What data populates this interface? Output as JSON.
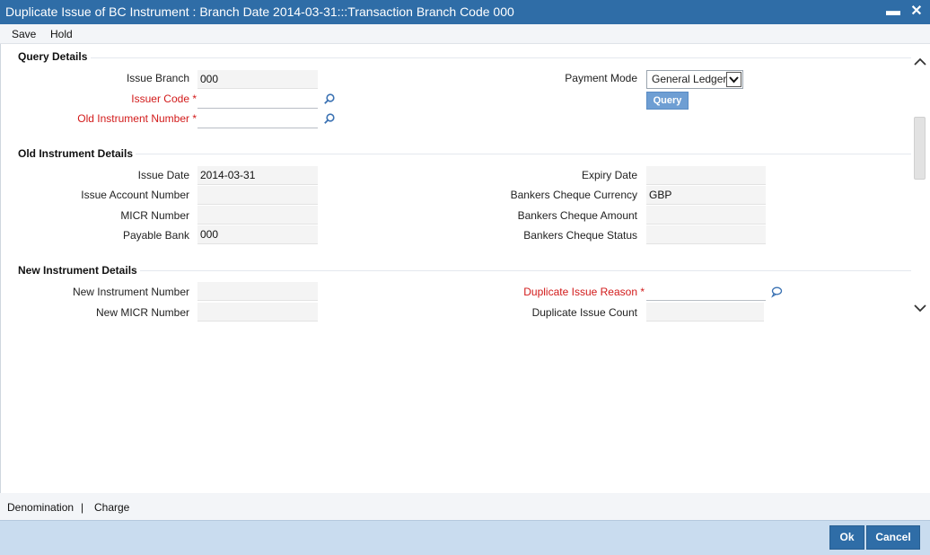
{
  "window": {
    "title": "Duplicate Issue of BC Instrument : Branch Date 2014-03-31:::Transaction Branch Code 000",
    "minimize_glyph": "▬",
    "close_glyph": "✕"
  },
  "menu": {
    "save": "Save",
    "hold": "Hold"
  },
  "query_details": {
    "heading": "Query Details",
    "issue_branch": {
      "label": "Issue Branch",
      "value": "000"
    },
    "issuer_code": {
      "label": "Issuer Code *",
      "value": ""
    },
    "old_instrument_number": {
      "label": "Old Instrument Number *",
      "value": ""
    },
    "payment_mode": {
      "label": "Payment Mode",
      "value": "General Ledger"
    },
    "query_button": "Query"
  },
  "old_instrument": {
    "heading": "Old Instrument Details",
    "issue_date": {
      "label": "Issue Date",
      "value": "2014-03-31"
    },
    "issue_account_number": {
      "label": "Issue Account Number",
      "value": ""
    },
    "micr_number": {
      "label": "MICR Number",
      "value": ""
    },
    "payable_bank": {
      "label": "Payable Bank",
      "value": "000"
    },
    "expiry_date": {
      "label": "Expiry Date",
      "value": ""
    },
    "bankers_cheque_currency": {
      "label": "Bankers Cheque Currency",
      "value": "GBP"
    },
    "bankers_cheque_amount": {
      "label": "Bankers Cheque Amount",
      "value": ""
    },
    "bankers_cheque_status": {
      "label": "Bankers Cheque Status",
      "value": ""
    }
  },
  "new_instrument": {
    "heading": "New Instrument Details",
    "new_instrument_number": {
      "label": "New Instrument Number",
      "value": ""
    },
    "new_micr_number": {
      "label": "New MICR Number",
      "value": ""
    },
    "duplicate_issue_reason": {
      "label": "Duplicate Issue Reason *",
      "value": ""
    },
    "duplicate_issue_count": {
      "label": "Duplicate Issue Count",
      "value": ""
    }
  },
  "footer_links": {
    "denomination": "Denomination",
    "separator": "|",
    "charge": "Charge"
  },
  "buttons": {
    "ok": "Ok",
    "cancel": "Cancel"
  },
  "icons": {
    "lov": "search-icon",
    "reason_lov": "speech-bubble-icon",
    "scroll_up": "chevron-up-icon",
    "scroll_down": "chevron-down-icon"
  },
  "colors": {
    "title_bar": "#2f6da7",
    "required_label": "#d21a1a",
    "query_button": "#6e9ed3",
    "footer_bar": "#c9dcef"
  }
}
